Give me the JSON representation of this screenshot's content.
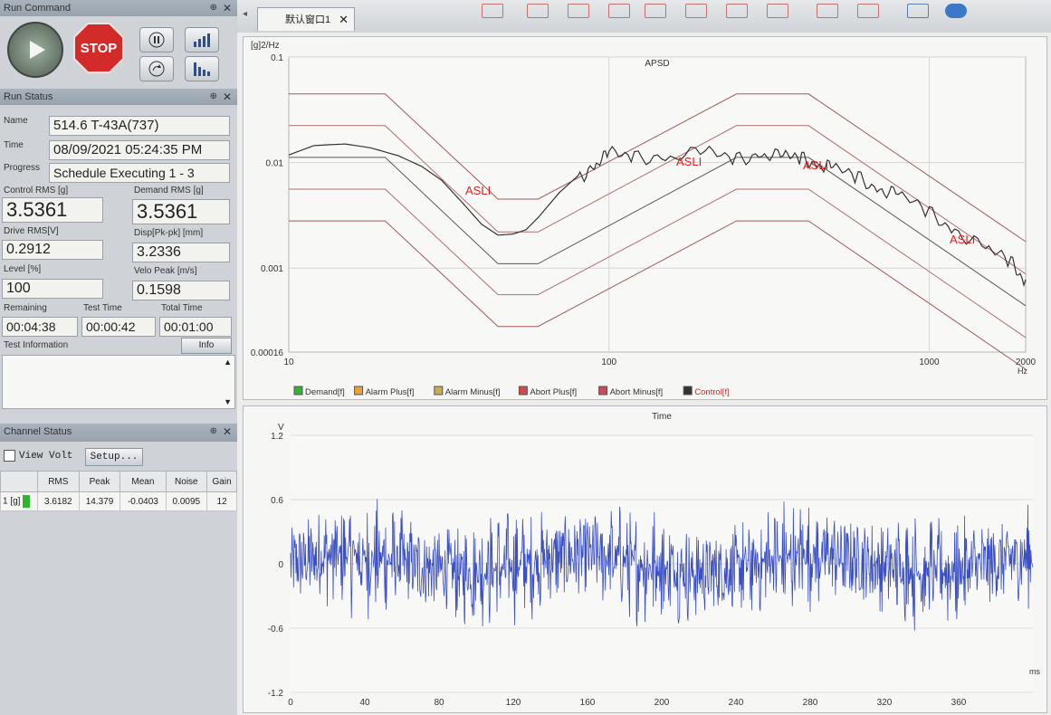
{
  "left": {
    "command_title": "Run Command",
    "stop_label": "STOP",
    "status_title": "Run Status",
    "name_label": "Name",
    "name_value": "514.6 T-43A(737)",
    "time_label": "Time",
    "time_value": "08/09/2021 05:24:35 PM",
    "progress_label": "Progress",
    "progress_value": "Schedule Executing 1 - 3",
    "control_rms_label": "Control RMS [g]",
    "control_rms_value": "3.5361",
    "demand_rms_label": "Demand RMS [g]",
    "demand_rms_value": "3.5361",
    "drive_rms_label": "Drive RMS[V]",
    "drive_rms_value": "0.2912",
    "disp_label": "Disp[Pk-pk] [mm]",
    "disp_value": "3.2336",
    "level_label": "Level [%]",
    "level_value": "100",
    "velo_label": "Velo Peak [m/s]",
    "velo_value": "0.1598",
    "remaining_label": "Remaining",
    "remaining_value": "00:04:38",
    "test_time_label": "Test Time",
    "test_time_value": "00:00:42",
    "total_time_label": "Total Time",
    "total_time_value": "00:01:00",
    "test_info_label": "Test Information",
    "info_button": "Info",
    "channel_title": "Channel Status",
    "view_volt_label": "View Volt",
    "setup_button": "Setup...",
    "channel_headers": [
      "",
      "RMS",
      "Peak",
      "Mean",
      "Noise",
      "Gain"
    ],
    "channel_rows": [
      [
        "1 [g]",
        "3.6182",
        "14.379",
        "-0.0403",
        "0.0095",
        "12"
      ]
    ]
  },
  "tab": {
    "label": "默认窗口1"
  },
  "chart_data": [
    {
      "type": "line",
      "title": "APSD",
      "ylabel": "[g]2/Hz",
      "xlabel": "Hz",
      "x_scale": "log",
      "y_scale": "log",
      "xlim": [
        10,
        2000
      ],
      "ylim": [
        0.00016,
        0.1
      ],
      "x_ticks": [
        "10",
        "100",
        "1000",
        "2000"
      ],
      "y_ticks": [
        "0.1",
        "0.01",
        "0.001",
        "0.00016"
      ],
      "legend": [
        "Demand[f]",
        "Alarm Plus[f]",
        "Alarm Minus[f]",
        "Abort Plus[f]",
        "Abort Minus[f]",
        "Control[f]"
      ],
      "legend_placement": "bottom",
      "annotations": [
        "ASLI",
        "ASLI",
        "ASLI",
        "ASLI"
      ],
      "series": [
        {
          "name": "Demand[f]",
          "color": "#5a5a5a",
          "points": [
            [
              10,
              0.0112
            ],
            [
              20,
              0.0112
            ],
            [
              45,
              0.0011
            ],
            [
              60,
              0.0011
            ],
            [
              250,
              0.0112
            ],
            [
              420,
              0.0112
            ],
            [
              2000,
              0.00044
            ]
          ]
        },
        {
          "name": "Alarm Plus[f]",
          "color": "#b07070",
          "points": [
            [
              10,
              0.0224
            ],
            [
              20,
              0.0224
            ],
            [
              45,
              0.0022
            ],
            [
              60,
              0.0022
            ],
            [
              250,
              0.0224
            ],
            [
              420,
              0.0224
            ],
            [
              2000,
              0.00088
            ]
          ]
        },
        {
          "name": "Alarm Minus[f]",
          "color": "#b07070",
          "points": [
            [
              10,
              0.0056
            ],
            [
              20,
              0.0056
            ],
            [
              45,
              0.00056
            ],
            [
              60,
              0.00056
            ],
            [
              250,
              0.0056
            ],
            [
              420,
              0.0056
            ],
            [
              2000,
              0.00022
            ]
          ]
        },
        {
          "name": "Abort Plus[f]",
          "color": "#9e5a5a",
          "points": [
            [
              10,
              0.0447
            ],
            [
              20,
              0.0447
            ],
            [
              45,
              0.0045
            ],
            [
              60,
              0.0045
            ],
            [
              250,
              0.0447
            ],
            [
              420,
              0.0447
            ],
            [
              2000,
              0.00178
            ]
          ]
        },
        {
          "name": "Abort Minus[f]",
          "color": "#9e5a5a",
          "points": [
            [
              10,
              0.0028
            ],
            [
              20,
              0.0028
            ],
            [
              45,
              0.00028
            ],
            [
              60,
              0.00028
            ],
            [
              250,
              0.0028
            ],
            [
              420,
              0.0028
            ],
            [
              2000,
              0.00011
            ]
          ]
        },
        {
          "name": "Control[f]",
          "color": "#333333",
          "points": [
            [
              10,
              0.0118
            ],
            [
              12,
              0.0145
            ],
            [
              15,
              0.015
            ],
            [
              18,
              0.0138
            ],
            [
              22,
              0.0116
            ],
            [
              26,
              0.0092
            ],
            [
              30,
              0.0068
            ],
            [
              35,
              0.0041
            ],
            [
              40,
              0.0026
            ],
            [
              45,
              0.00205
            ],
            [
              50,
              0.0021
            ],
            [
              55,
              0.0023
            ],
            [
              60,
              0.003
            ],
            [
              70,
              0.0052
            ],
            [
              80,
              0.0075
            ],
            [
              90,
              0.0092
            ],
            [
              100,
              0.0115
            ],
            [
              120,
              0.012
            ],
            [
              150,
              0.0112
            ],
            [
              200,
              0.0118
            ],
            [
              250,
              0.0112
            ],
            [
              300,
              0.0122
            ],
            [
              350,
              0.0108
            ],
            [
              400,
              0.0112
            ],
            [
              450,
              0.0098
            ],
            [
              500,
              0.0085
            ],
            [
              600,
              0.0072
            ],
            [
              700,
              0.0058
            ],
            [
              800,
              0.0048
            ],
            [
              1000,
              0.0033
            ],
            [
              1200,
              0.0024
            ],
            [
              1500,
              0.0015
            ],
            [
              1800,
              0.0011
            ],
            [
              2000,
              0.00078
            ]
          ]
        }
      ]
    },
    {
      "type": "line",
      "title": "Time",
      "ylabel": "V",
      "xlabel": "ms",
      "xlim": [
        0,
        400
      ],
      "ylim": [
        -1.2,
        1.2
      ],
      "x_ticks": [
        "0",
        "40",
        "80",
        "120",
        "160",
        "200",
        "240",
        "280",
        "320",
        "360"
      ],
      "y_ticks": [
        "1.2",
        "0.6",
        "0",
        "-0.6",
        "-1.2"
      ],
      "series": [
        {
          "color": "#3b4fc4",
          "amplitude": 0.6,
          "peak": 1.0,
          "min": -0.72
        }
      ]
    }
  ]
}
